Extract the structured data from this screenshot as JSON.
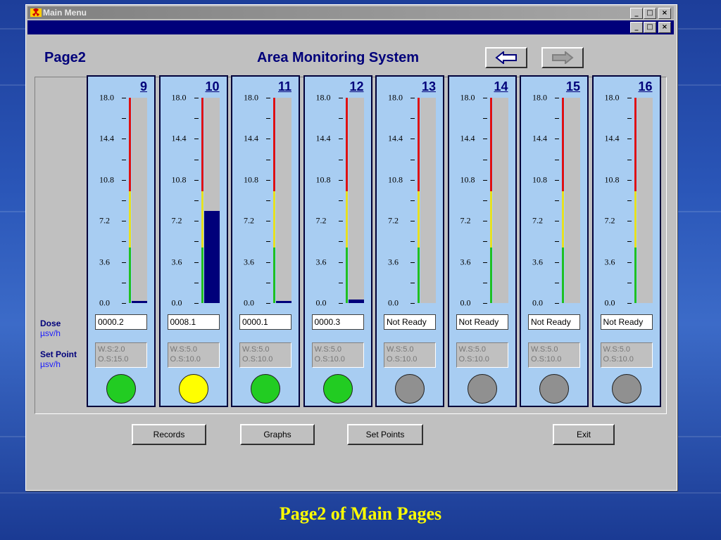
{
  "window": {
    "title": "Main Menu"
  },
  "header": {
    "page_label": "Page2",
    "app_title": "Area Monitoring System"
  },
  "labels": {
    "dose": "Dose",
    "dose_unit": "µsv/h",
    "set_point": "Set Point",
    "set_point_unit": "µsv/h"
  },
  "scale": {
    "ticks": [
      "18.0",
      "14.4",
      "10.8",
      "7.2",
      "3.6",
      "0.0"
    ],
    "max": 18.0
  },
  "channels": [
    {
      "number": "9",
      "dose": "0000.2",
      "value": 0.2,
      "ws": "W.S:2.0",
      "os": "O.S:15.0",
      "status_color": "#22cc22"
    },
    {
      "number": "10",
      "dose": "0008.1",
      "value": 8.1,
      "ws": "W.S:5.0",
      "os": "O.S:10.0",
      "status_color": "#ffff00"
    },
    {
      "number": "11",
      "dose": "0000.1",
      "value": 0.1,
      "ws": "W.S:5.0",
      "os": "O.S:10.0",
      "status_color": "#22cc22"
    },
    {
      "number": "12",
      "dose": "0000.3",
      "value": 0.3,
      "ws": "W.S:5.0",
      "os": "O.S:10.0",
      "status_color": "#22cc22"
    },
    {
      "number": "13",
      "dose": "Not Ready",
      "value": 0,
      "ws": "W.S:5.0",
      "os": "O.S:10.0",
      "status_color": "#909090"
    },
    {
      "number": "14",
      "dose": "Not Ready",
      "value": 0,
      "ws": "W.S:5.0",
      "os": "O.S:10.0",
      "status_color": "#909090"
    },
    {
      "number": "15",
      "dose": "Not Ready",
      "value": 0,
      "ws": "W.S:5.0",
      "os": "O.S:10.0",
      "status_color": "#909090"
    },
    {
      "number": "16",
      "dose": "Not Ready",
      "value": 0,
      "ws": "W.S:5.0",
      "os": "O.S:10.0",
      "status_color": "#909090"
    }
  ],
  "buttons": {
    "records": "Records",
    "graphs": "Graphs",
    "set_points": "Set Points",
    "exit": "Exit"
  },
  "icons": {
    "app": "radiation-icon",
    "back": "arrow-left-icon",
    "forward": "arrow-right-icon"
  },
  "caption": "Page2 of Main Pages"
}
